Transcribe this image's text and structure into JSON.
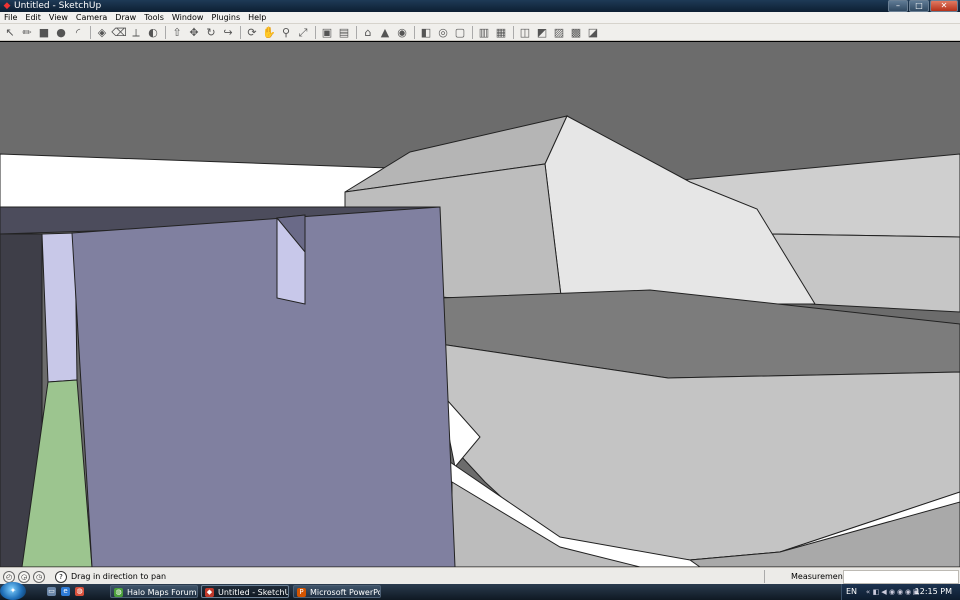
{
  "window": {
    "title": "Untitled - SketchUp",
    "controls": {
      "minimize": "–",
      "maximize": "□",
      "close": "✕"
    }
  },
  "menu": {
    "items": [
      "File",
      "Edit",
      "View",
      "Camera",
      "Draw",
      "Tools",
      "Window",
      "Plugins",
      "Help"
    ]
  },
  "toolbar": {
    "tools": [
      {
        "name": "select-tool-icon",
        "glyph": "↖"
      },
      {
        "name": "line-tool-icon",
        "glyph": "✏"
      },
      {
        "name": "rectangle-tool-icon",
        "glyph": "■"
      },
      {
        "name": "circle-tool-icon",
        "glyph": "●"
      },
      {
        "name": "arc-tool-icon",
        "glyph": "◜"
      },
      {
        "sep": true
      },
      {
        "name": "make-component-icon",
        "glyph": "◈"
      },
      {
        "name": "eraser-tool-icon",
        "glyph": "⌫"
      },
      {
        "name": "tape-measure-icon",
        "glyph": "⟂"
      },
      {
        "name": "paint-bucket-icon",
        "glyph": "◐"
      },
      {
        "sep": true
      },
      {
        "name": "push-pull-icon",
        "glyph": "⇧"
      },
      {
        "name": "move-tool-icon",
        "glyph": "✥"
      },
      {
        "name": "rotate-tool-icon",
        "glyph": "↻"
      },
      {
        "name": "follow-me-icon",
        "glyph": "↪"
      },
      {
        "sep": true
      },
      {
        "name": "orbit-tool-icon",
        "glyph": "⟳"
      },
      {
        "name": "pan-tool-icon",
        "glyph": "✋"
      },
      {
        "name": "zoom-tool-icon",
        "glyph": "⚲"
      },
      {
        "name": "zoom-extents-icon",
        "glyph": "⤢"
      },
      {
        "sep": true
      },
      {
        "name": "get-models-icon",
        "glyph": "▣"
      },
      {
        "name": "share-model-icon",
        "glyph": "▤"
      },
      {
        "sep": true
      },
      {
        "name": "add-location-icon",
        "glyph": "⌂"
      },
      {
        "name": "toggle-terrain-icon",
        "glyph": "▲"
      },
      {
        "name": "google-earth-icon",
        "glyph": "◉"
      },
      {
        "sep": true
      },
      {
        "name": "shadows-icon",
        "glyph": "◧"
      },
      {
        "name": "fog-icon",
        "glyph": "◎"
      },
      {
        "name": "section-plane-icon",
        "glyph": "▢"
      },
      {
        "sep": true
      },
      {
        "name": "x-ray-icon",
        "glyph": "▥"
      },
      {
        "name": "wireframe-icon",
        "glyph": "▦"
      },
      {
        "sep": true
      },
      {
        "name": "hidden-line-icon",
        "glyph": "◫"
      },
      {
        "name": "shaded-icon",
        "glyph": "◩"
      },
      {
        "name": "shaded-textures-icon",
        "glyph": "▨"
      },
      {
        "name": "monochrome-icon",
        "glyph": "▩"
      },
      {
        "name": "style-icon",
        "glyph": "◪"
      }
    ]
  },
  "status": {
    "hint": "Drag in direction to pan",
    "measurements_label": "Measurements",
    "measurements_value": "",
    "status_icons": [
      "◴",
      "◶",
      "◷"
    ],
    "help_glyph": "?"
  },
  "taskbar": {
    "quick_launch": [
      {
        "name": "show-desktop-icon",
        "glyph": "▭"
      },
      {
        "name": "ie-icon",
        "glyph": "e"
      },
      {
        "name": "chrome-icon",
        "glyph": "◍"
      }
    ],
    "buttons": [
      {
        "name": "taskbar-halo-maps",
        "label": "Halo Maps Forum - ...",
        "active": false,
        "glyph": "◍"
      },
      {
        "name": "taskbar-sketchup",
        "label": "Untitled - SketchUp",
        "active": true,
        "glyph": "◆"
      },
      {
        "name": "taskbar-powerpoint",
        "label": "Microsoft PowerPoi...",
        "active": false,
        "glyph": "P"
      }
    ],
    "language": "EN",
    "tray_icons": [
      {
        "name": "tray-arrow-icon",
        "glyph": "«"
      },
      {
        "name": "tray-network-icon",
        "glyph": "◧"
      },
      {
        "name": "tray-volume-icon",
        "glyph": "◀"
      },
      {
        "name": "tray-app1-icon",
        "glyph": "◉"
      },
      {
        "name": "tray-app2-icon",
        "glyph": "◉"
      },
      {
        "name": "tray-app3-icon",
        "glyph": "◉"
      },
      {
        "name": "tray-app4-icon",
        "glyph": "▣"
      }
    ],
    "clock": "12:15 PM"
  },
  "colors": {
    "accent": "#1e3a56",
    "wall": "#8080a0",
    "floor": "#9cc58f",
    "sky": "#6c6c6c"
  }
}
